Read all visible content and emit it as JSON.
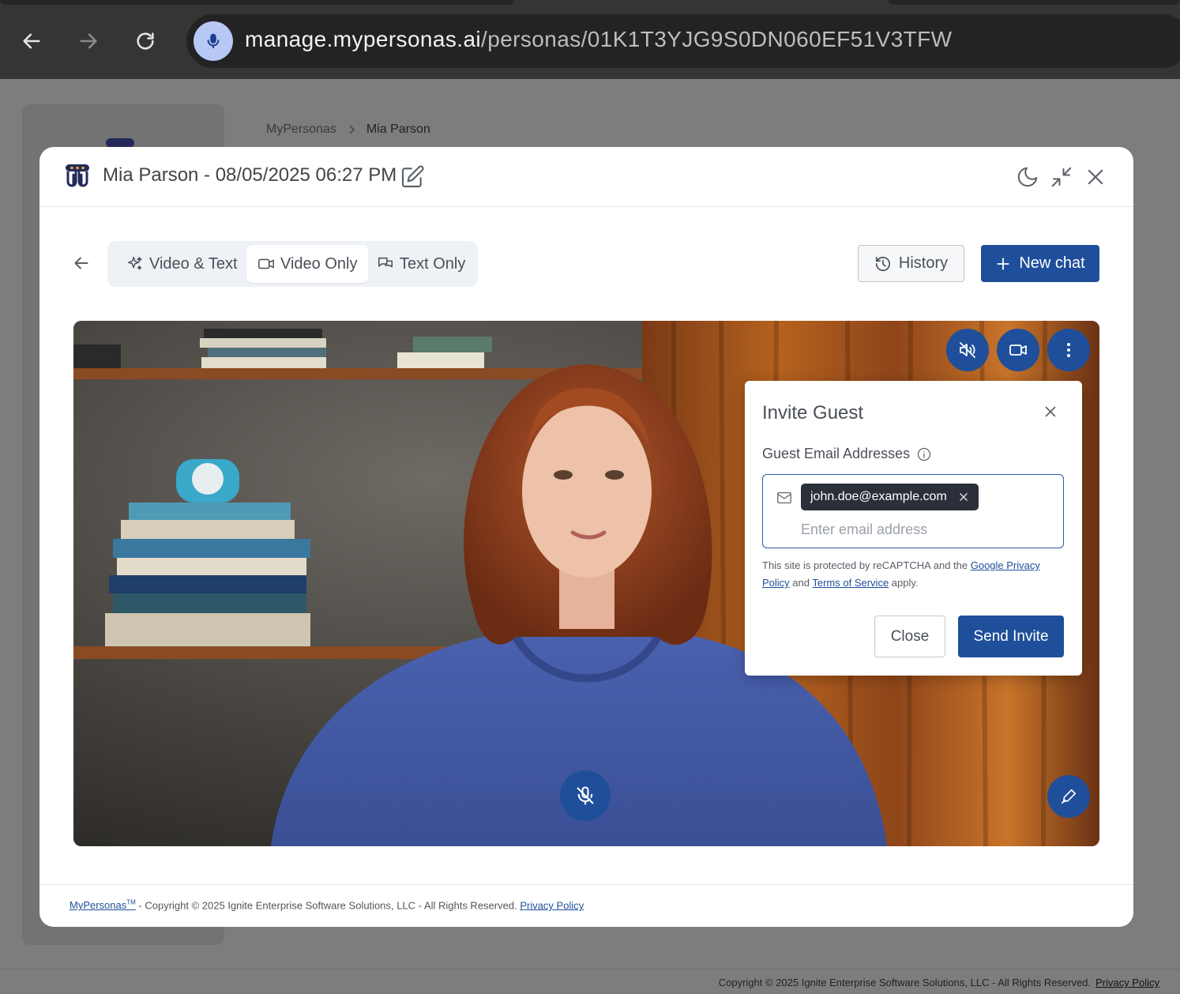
{
  "browser": {
    "url_domain": "manage.mypersonas.ai",
    "url_path": "/personas/01K1T3YJG9S0DN060EF51V3TFW"
  },
  "background": {
    "breadcrumb": [
      "MyPersonas",
      "Mia Parson"
    ],
    "footer_text": "Copyright © 2025 Ignite Enterprise Software Solutions, LLC - All Rights Reserved.",
    "footer_link": "Privacy Policy"
  },
  "modal": {
    "title": "Mia Parson - 08/05/2025 06:27 PM",
    "modes": [
      {
        "label": "Video & Text",
        "icon": "sparkles-icon",
        "active": false
      },
      {
        "label": "Video Only",
        "icon": "video-camera-icon",
        "active": true
      },
      {
        "label": "Text Only",
        "icon": "chat-bubbles-icon",
        "active": false
      }
    ],
    "history_label": "History",
    "new_chat_label": "New chat",
    "footer": {
      "brand": "MyPersonas",
      "tm": "TM",
      "copyright": " - Copyright © 2025 Ignite Enterprise Software Solutions, LLC - All Rights Reserved.",
      "privacy": "Privacy Policy"
    }
  },
  "invite": {
    "title": "Invite Guest",
    "label": "Guest Email Addresses",
    "chip": "john.doe@example.com",
    "placeholder": "Enter email address",
    "recaptcha_pre": "This site is protected by reCAPTCHA and the ",
    "recaptcha_link1": "Google Privacy Policy",
    "recaptcha_mid": " and ",
    "recaptcha_link2": "Terms of Service",
    "recaptcha_post": " apply.",
    "close_label": "Close",
    "send_label": "Send Invite"
  },
  "colors": {
    "primary": "#1f4f9a",
    "chip_bg": "#2b2f3a"
  }
}
